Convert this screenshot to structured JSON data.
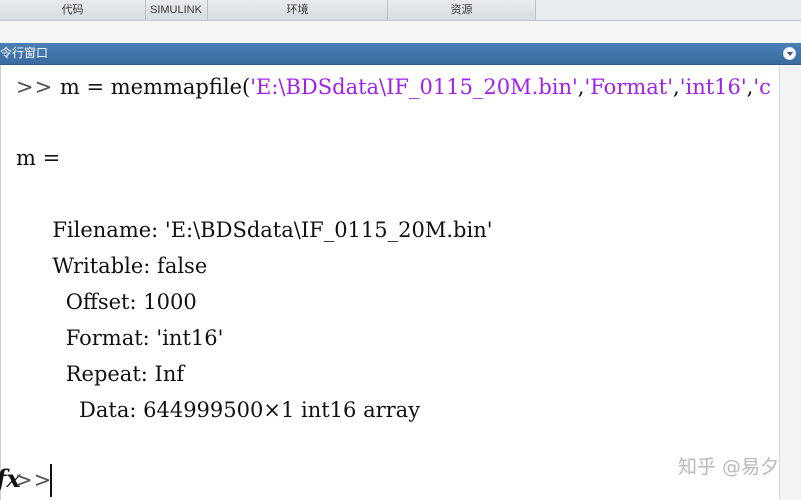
{
  "toolstrip": {
    "tabs": [
      "",
      "代码",
      "SIMULINK",
      "环境",
      "资源"
    ]
  },
  "command_window": {
    "title": "令行窗口",
    "command": {
      "prompt": ">>",
      "pre": " m = memmapfile(",
      "arg1": "'E:\\BDSdata\\IF_0115_20M.bin'",
      "comma1": ",",
      "arg2": "'Format'",
      "comma2": ",",
      "arg3": "'int16'",
      "comma3": ",",
      "arg4": "'c"
    },
    "output_var": "m =",
    "fields": [
      {
        "text": "  Filename: 'E:\\BDSdata\\IF_0115_20M.bin'"
      },
      {
        "text": "  Writable: false"
      },
      {
        "text": "    Offset: 1000"
      },
      {
        "text": "    Format: 'int16'"
      },
      {
        "text": "    Repeat: Inf"
      },
      {
        "text": "      Data: 644999500×1 int16 array"
      }
    ],
    "fx_label": "fx",
    "bottom_prompt": ">>"
  },
  "watermark": "知乎 @易夕"
}
